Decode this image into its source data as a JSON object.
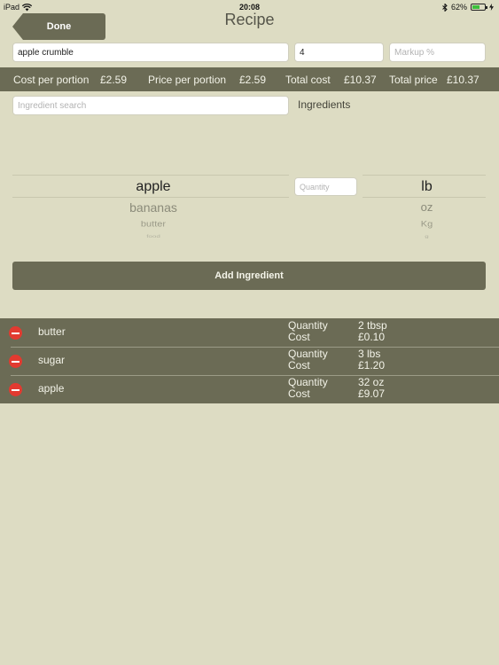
{
  "status": {
    "device": "iPad",
    "time": "20:08",
    "battery_percent": "62%",
    "battery_level": 0.62
  },
  "header": {
    "done_label": "Done",
    "title": "Recipe"
  },
  "form": {
    "recipe_name_value": "apple crumble",
    "portions_value": "4",
    "markup_placeholder": "Markup %"
  },
  "summary": {
    "cost_per_portion_label": "Cost per portion",
    "cost_per_portion_value": "£2.59",
    "price_per_portion_label": "Price per portion",
    "price_per_portion_value": "£2.59",
    "total_cost_label": "Total cost",
    "total_cost_value": "£10.37",
    "total_price_label": "Total price",
    "total_price_value": "£10.37"
  },
  "search": {
    "placeholder": "Ingredient search",
    "ingredients_label": "Ingredients"
  },
  "picker": {
    "ingredients": [
      "apple",
      "bananas",
      "butter",
      "food"
    ],
    "selected_ingredient": "apple",
    "quantity_placeholder": "Quantity",
    "units": [
      "lb",
      "oz",
      "Kg",
      "g"
    ],
    "selected_unit": "lb"
  },
  "add_button_label": "Add Ingredient",
  "list": {
    "quantity_label": "Quantity",
    "cost_label": "Cost",
    "items": [
      {
        "name": "butter",
        "quantity": "2 tbsp",
        "cost": "£0.10"
      },
      {
        "name": "sugar",
        "quantity": "3 lbs",
        "cost": "£1.20"
      },
      {
        "name": "apple",
        "quantity": "32 oz",
        "cost": "£9.07"
      }
    ]
  },
  "colors": {
    "background": "#dddcc3",
    "bar": "#6b6b55",
    "delete": "#e23a30",
    "battery": "#3bbf3b"
  }
}
